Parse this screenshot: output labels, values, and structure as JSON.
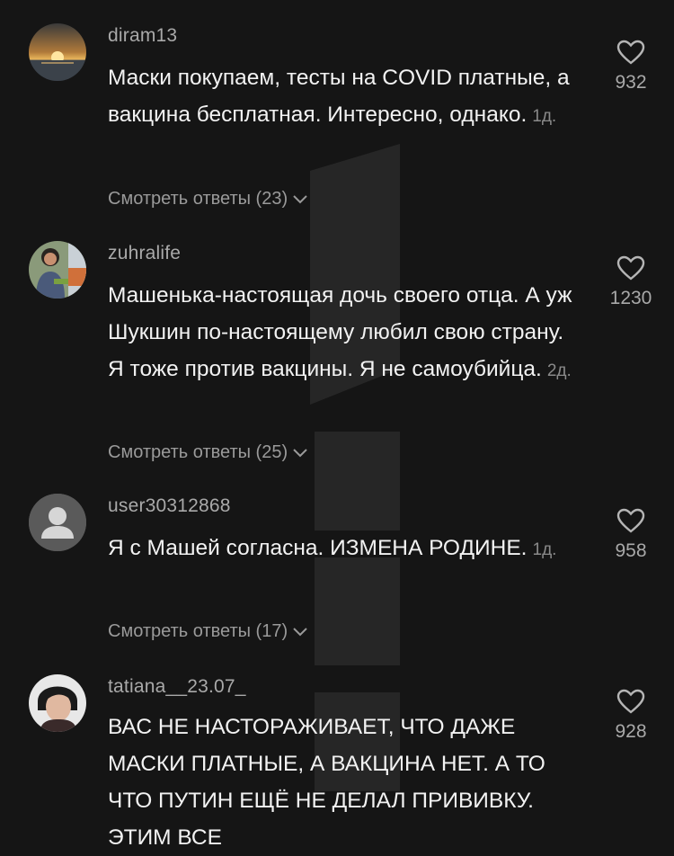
{
  "comments": [
    {
      "username": "diram13",
      "text": "Маски покупаем, тесты на COVID платные, а вакцина бесплатная. Интересно, однако.",
      "time": "1д.",
      "replies": "Смотреть ответы (23)",
      "likes": "932",
      "avatar": "sunset-photo"
    },
    {
      "username": "zuhralife",
      "text": "Машенька-настоящая дочь своего отца. А уж Шукшин по-настоящему любил свою страну. Я тоже против вакцины. Я не самоубийца.",
      "time": "2д.",
      "replies": "Смотреть ответы (25)",
      "likes": "1230",
      "avatar": "person-photo"
    },
    {
      "username": "user30312868",
      "text": "Я с Машей согласна. ИЗМЕНА РОДИНЕ.",
      "time": "1д.",
      "replies": "Смотреть ответы (17)",
      "likes": "958",
      "avatar": "default-person"
    },
    {
      "username": "tatiana__23.07_",
      "text": "ВАС НЕ НАСТОРАЖИВАЕТ, ЧТО ДАЖЕ МАСКИ ПЛАТНЫЕ, А ВАКЦИНА НЕТ. А ТО ЧТО ПУТИН ЕЩЁ НЕ ДЕЛАЛ ПРИВИВКУ. ЭТИМ ВСЕ",
      "time": "",
      "replies": "",
      "likes": "928",
      "avatar": "woman-photo"
    }
  ],
  "colors": {
    "background": "#151515",
    "text": "#f2f2f2",
    "muted": "#a9a9a9"
  }
}
